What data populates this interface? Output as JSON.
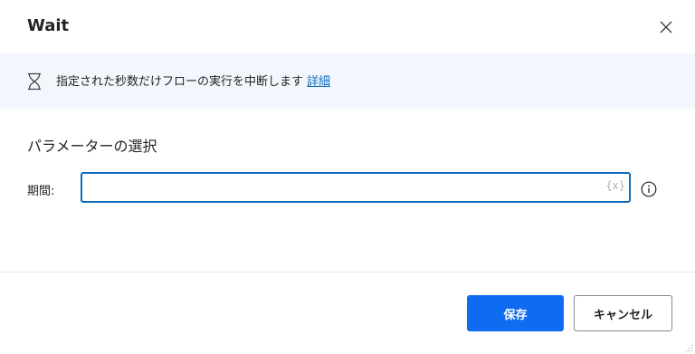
{
  "dialog": {
    "title": "Wait"
  },
  "banner": {
    "icon": "hourglass-icon",
    "text": "指定された秒数だけフローの実行を中断します",
    "link": "詳細"
  },
  "parameters": {
    "section_title": "パラメーターの選択",
    "duration_label": "期間:",
    "duration_value": "",
    "variable_button": "{x}"
  },
  "footer": {
    "save_label": "保存",
    "cancel_label": "キャンセル"
  },
  "colors": {
    "accent": "#0f6cbd",
    "primary_button": "#0f6cf0",
    "banner_bg": "#f3f7fd"
  }
}
